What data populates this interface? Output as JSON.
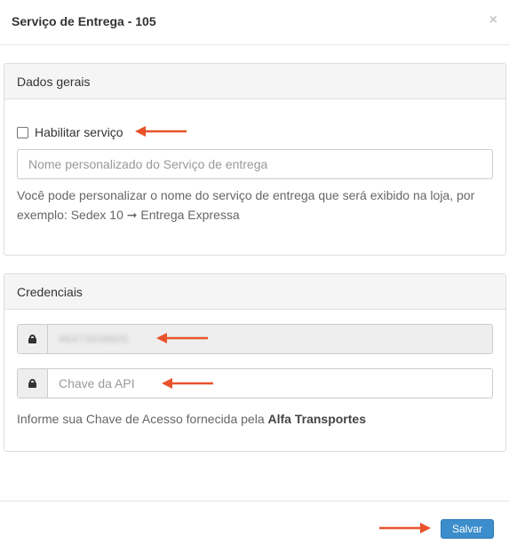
{
  "modal": {
    "title": "Serviço de Entrega - 105",
    "close_symbol": "×"
  },
  "general_panel": {
    "heading": "Dados gerais",
    "checkbox_label": "Habilitar serviço",
    "checkbox_checked": false,
    "name_input_placeholder": "Nome personalizado do Serviço de entrega",
    "name_input_value": "",
    "help_text": "Você pode personalizar o nome do serviço de entrega que será exibido na loja, por exemplo: Sedex 10 ➞ Entrega Expressa"
  },
  "credentials_panel": {
    "heading": "Credenciais",
    "user_field_icon": "lock-icon",
    "user_field_value": "46473438805",
    "key_field_icon": "lock-icon",
    "key_input_placeholder": "Chave da API",
    "key_input_value": "",
    "help_prefix": "Informe sua Chave de Acesso fornecida pela ",
    "help_company": "Alfa Transportes"
  },
  "footer": {
    "save_label": "Salvar"
  },
  "colors": {
    "accent": "#3c8dcb",
    "annotation_arrow": "#e8532b",
    "panel_heading_bg": "#f5f5f5"
  }
}
